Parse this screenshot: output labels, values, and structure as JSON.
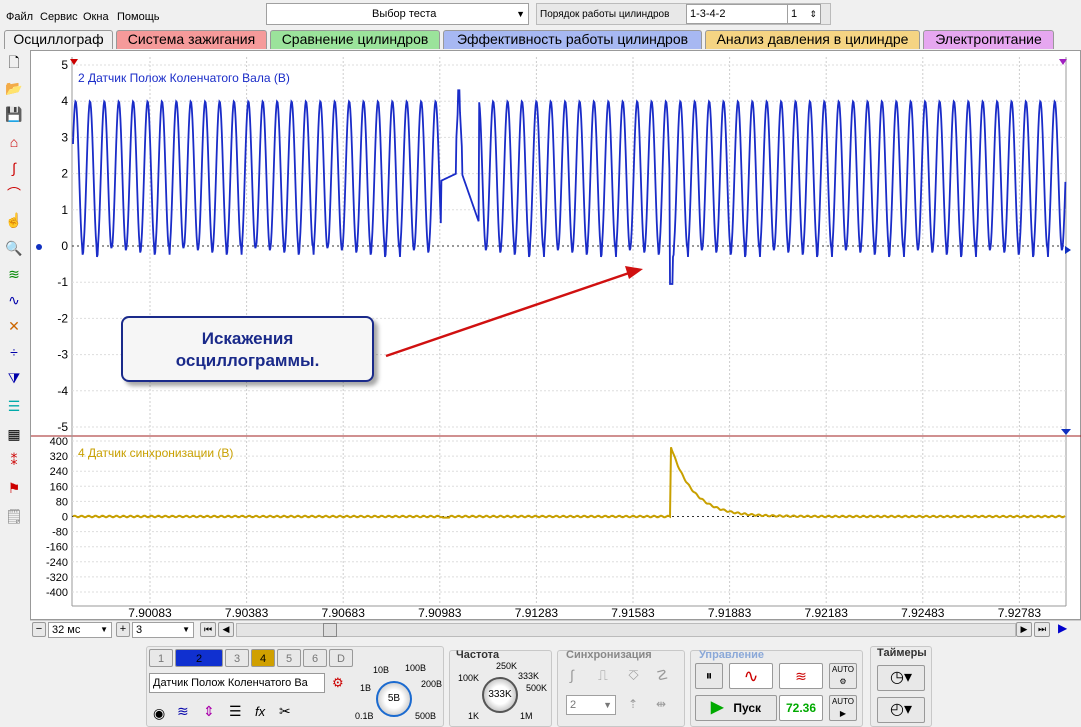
{
  "menu": {
    "file": "Файл",
    "service": "Сервис",
    "windows": "Окна",
    "help": "Помощь"
  },
  "test_select": {
    "label": "Выбор теста"
  },
  "cyl_order": {
    "label": "Порядок работы цилиндров",
    "value": "1-3-4-2",
    "spin": "1"
  },
  "tabs": [
    {
      "label": "Осциллограф",
      "color": "#f0f0f0"
    },
    {
      "label": "Система зажигания",
      "color": "#f59a9a"
    },
    {
      "label": "Сравнение цилиндров",
      "color": "#9be39b"
    },
    {
      "label": "Эффективность работы цилиндров",
      "color": "#a7b8f2"
    },
    {
      "label": "Анализ давления в цилиндре",
      "color": "#f5d483"
    },
    {
      "label": "Электропитание",
      "color": "#e6a7f0"
    }
  ],
  "chart_data": [
    {
      "type": "line",
      "title": "2 Датчик Полож Коленчатого Вала (В)",
      "ylim": [
        -5,
        5
      ],
      "yticks": [
        "5",
        "4",
        "3",
        "2",
        "1",
        "0",
        "-1",
        "-2",
        "-3",
        "-4",
        "-5"
      ],
      "series": [
        {
          "name": "2 Датчик Полож Коленчатого Вала (В)",
          "color": "#1a2cc8"
        }
      ]
    },
    {
      "type": "line",
      "title": "4 Датчик синхронизации (В)",
      "ylim": [
        -400,
        400
      ],
      "yticks": [
        "400",
        "320",
        "240",
        "160",
        "80",
        "0",
        "-80",
        "-160",
        "-240",
        "-320",
        "-400"
      ],
      "series": [
        {
          "name": "4 Датчик синхронизации (В)",
          "color": "#c8a000"
        }
      ]
    }
  ],
  "xticks": [
    "7.90083",
    "7.90383",
    "7.90683",
    "7.90983",
    "7.91283",
    "7.91583",
    "7.91883",
    "7.92183",
    "7.92483",
    "7.92783"
  ],
  "callout": {
    "line1": "Искажения",
    "line2": "осциллограммы."
  },
  "bottom": {
    "time": "32 мс",
    "zoom": "3"
  },
  "channels": {
    "buttons": [
      "1",
      "2",
      "3",
      "4",
      "5",
      "6",
      "D"
    ],
    "sensor": "Датчик Полож Коленчатого Ва"
  },
  "scale": {
    "labels": [
      "10В",
      "100В",
      "1В",
      "200В",
      "0.1В",
      "500В"
    ],
    "value": "5В"
  },
  "freq": {
    "title": "Частота",
    "labels": [
      "100K",
      "250K",
      "333K",
      "500K",
      "1K",
      "1M"
    ],
    "value": "333K"
  },
  "sync": {
    "title": "Синхронизация",
    "value": "2"
  },
  "control": {
    "title": "Управление",
    "start": "Пуск",
    "value": "72.36"
  },
  "timers": {
    "title": "Таймеры"
  },
  "colors": {
    "trace1": "#1a2cc8",
    "trace2": "#c8a000",
    "callout": "#1a2a8a",
    "arrow": "#d01010"
  }
}
